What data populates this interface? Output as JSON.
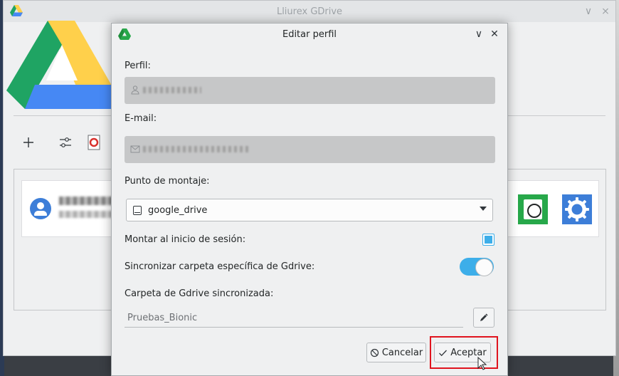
{
  "main_window": {
    "title": "Lliurex GDrive",
    "minimize_glyph": "∨",
    "close_glyph": "⨯",
    "toolbar": {
      "add_icon": "plus-icon",
      "settings_icon": "sliders-icon",
      "help_icon": "lifebuoy-icon"
    },
    "profile_card": {
      "mount_button_icon": "hard-drive-icon",
      "settings_button_icon": "gear-icon"
    }
  },
  "dialog": {
    "title": "Editar perfil",
    "minimize_glyph": "∨",
    "close_glyph": "✕",
    "profile_label": "Perfil:",
    "email_label": "E-mail:",
    "mount_point_label": "Punto de montaje:",
    "mount_point_value": "google_drive",
    "mount_at_login_label": "Montar al inicio de sesión:",
    "mount_at_login_checked": true,
    "sync_folder_label": "Sincronizar carpeta específica de Gdrive:",
    "sync_folder_enabled": true,
    "synced_folder_label": "Carpeta de Gdrive sincronizada:",
    "synced_folder_value": "Pruebas_Bionic",
    "cancel_label": "Cancelar",
    "accept_label": "Aceptar"
  },
  "colors": {
    "gdrive_green": "#1fa463",
    "gdrive_yellow": "#ffd04b",
    "gdrive_blue": "#4688f4",
    "accent": "#3daee9",
    "highlight": "#e0141e"
  }
}
